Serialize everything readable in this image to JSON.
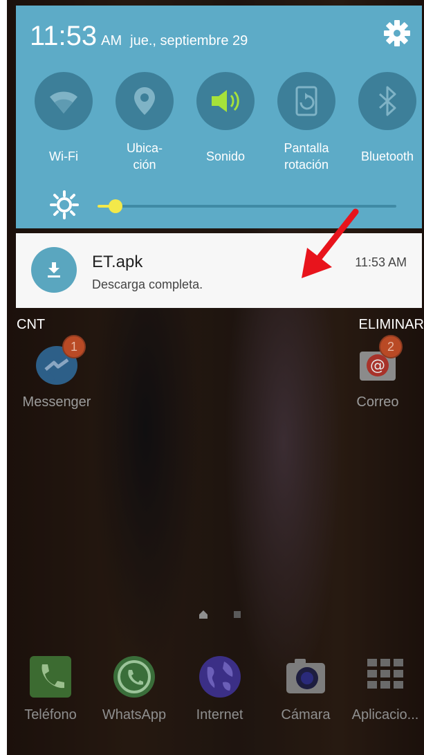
{
  "status": {
    "time": "11:53",
    "ampm": "AM",
    "date": "jue., septiembre 29",
    "settings_icon": "gear-icon"
  },
  "quick_toggles": [
    {
      "label": "Wi-Fi",
      "icon": "wifi-icon",
      "active": false
    },
    {
      "label": "Ubica-\nción",
      "icon": "location-icon",
      "active": false
    },
    {
      "label": "Sonido",
      "icon": "sound-icon",
      "active": true
    },
    {
      "label": "Pantalla\nrotación",
      "icon": "rotation-icon",
      "active": false
    },
    {
      "label": "Bluetooth",
      "icon": "bluetooth-icon",
      "active": false
    }
  ],
  "brightness": {
    "level": 0.06,
    "icon": "brightness-icon"
  },
  "notification": {
    "title": "ET.apk",
    "subtitle": "Descarga completa.",
    "time": "11:53 AM",
    "icon": "download-icon"
  },
  "footer": {
    "carrier": "CNT",
    "clear_label": "ELIMINAR"
  },
  "home_apps": [
    {
      "label": "Messenger",
      "badge": "1",
      "icon": "messenger-icon"
    },
    {
      "label": "Correo",
      "badge": "2",
      "icon": "email-icon"
    }
  ],
  "dock": [
    {
      "label": "Teléfono",
      "icon": "phone-icon"
    },
    {
      "label": "WhatsApp",
      "icon": "whatsapp-icon"
    },
    {
      "label": "Internet",
      "icon": "globe-icon"
    },
    {
      "label": "Cámara",
      "icon": "camera-icon"
    },
    {
      "label": "Aplicacio...",
      "icon": "apps-grid-icon"
    }
  ],
  "colors": {
    "panel": "#5dabc7",
    "toggle_circle": "#3d7f99",
    "active_icon": "#a6e23a",
    "slider": "#f3e94a",
    "annotation_arrow": "#e8141c"
  }
}
